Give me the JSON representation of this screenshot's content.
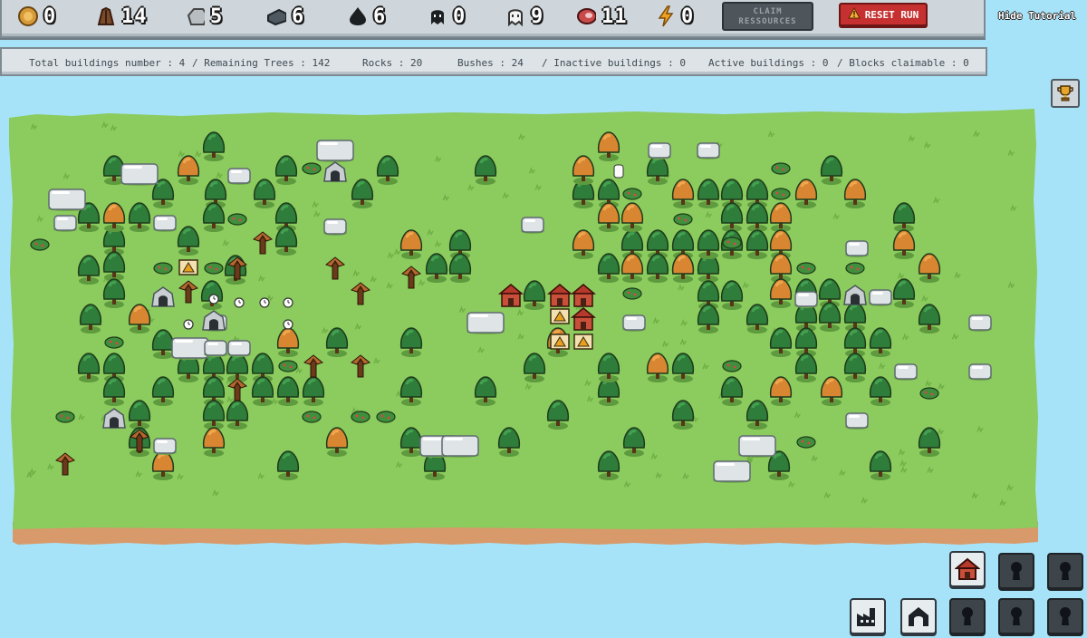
{
  "resources": [
    {
      "icon": "gold-coin-icon",
      "value": "0"
    },
    {
      "icon": "wood-logs-icon",
      "value": "14"
    },
    {
      "icon": "stone-icon",
      "value": "5"
    },
    {
      "icon": "iron-ingot-icon",
      "value": "6"
    },
    {
      "icon": "coal-icon",
      "value": "6"
    },
    {
      "icon": "dark-creature-icon",
      "value": "0"
    },
    {
      "icon": "white-creature-icon",
      "value": "9"
    },
    {
      "icon": "meat-icon",
      "value": "11"
    },
    {
      "icon": "energy-bolt-icon",
      "value": "0"
    }
  ],
  "buttons": {
    "claim_line1": "CLAIM",
    "claim_line2": "RESSOURCES",
    "reset": "RESET RUN",
    "hide_tutorial": "Hide Tutorial"
  },
  "stats": {
    "total_buildings": "Total buildings number : 4",
    "remaining_trees": "/ Remaining Trees : 142",
    "rocks": "Rocks : 20",
    "bushes": "Bushes : 24",
    "inactive": "/ Inactive buildings : 0",
    "active": "Active buildings : 0",
    "blocks": "/ Blocks claimable : 0"
  },
  "colors": {
    "water": "#a6e3f8",
    "grass": "#8ccb5e",
    "dirt": "#d89a6a",
    "tree_green": "#2f7d3a",
    "tree_orange": "#d98632",
    "rock": "#dfe4e6",
    "house_red": "#b63a2c",
    "reset_red": "#c63030"
  },
  "build_menu": [
    {
      "name": "house-build-button",
      "icon": "house-icon",
      "locked": false
    },
    {
      "name": "locked-slot-1",
      "icon": "keyhole-icon",
      "locked": true
    },
    {
      "name": "locked-slot-2",
      "icon": "keyhole-icon",
      "locked": true
    },
    {
      "name": "factory-build-button",
      "icon": "factory-icon",
      "locked": false
    },
    {
      "name": "shelter-build-button",
      "icon": "arch-icon",
      "locked": false
    },
    {
      "name": "locked-slot-3",
      "icon": "keyhole-icon",
      "locked": true
    },
    {
      "name": "locked-slot-4",
      "icon": "keyhole-icon",
      "locked": true
    },
    {
      "name": "locked-slot-5",
      "icon": "keyhole-icon",
      "locked": true
    }
  ]
}
